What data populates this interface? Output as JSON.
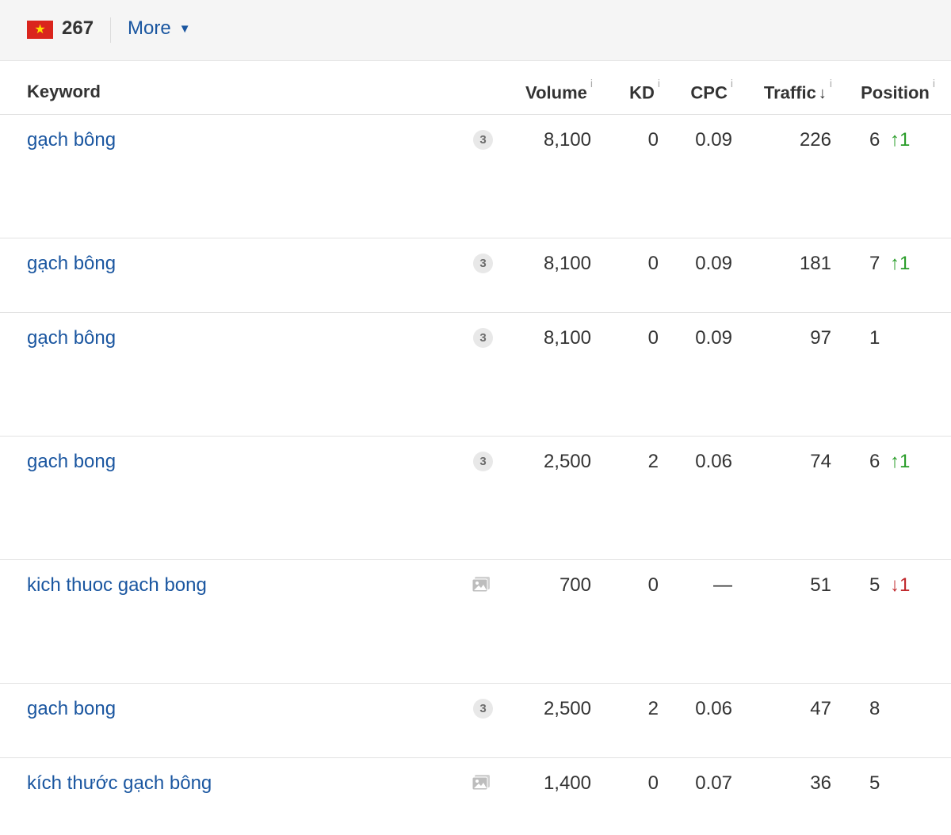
{
  "top": {
    "country_count": "267",
    "more_label": "More",
    "flag": "vietnam-flag"
  },
  "columns": {
    "keyword": "Keyword",
    "volume": "Volume",
    "kd": "KD",
    "cpc": "CPC",
    "traffic": "Traffic",
    "position": "Position",
    "info": "i",
    "sort": "↓"
  },
  "rows": [
    {
      "keyword": "gạch bông",
      "serp": "3",
      "serp_type": "count",
      "volume": "8,100",
      "kd": "0",
      "cpc": "0.09",
      "traffic": "226",
      "position": "6",
      "change": "↑1",
      "dir": "up"
    },
    {
      "keyword": "gạch bông",
      "serp": "3",
      "serp_type": "count",
      "volume": "8,100",
      "kd": "0",
      "cpc": "0.09",
      "traffic": "181",
      "position": "7",
      "change": "↑1",
      "dir": "up"
    },
    {
      "keyword": "gạch bông",
      "serp": "3",
      "serp_type": "count",
      "volume": "8,100",
      "kd": "0",
      "cpc": "0.09",
      "traffic": "97",
      "position": "1",
      "change": "",
      "dir": ""
    },
    {
      "keyword": "gach bong",
      "serp": "3",
      "serp_type": "count",
      "volume": "2,500",
      "kd": "2",
      "cpc": "0.06",
      "traffic": "74",
      "position": "6",
      "change": "↑1",
      "dir": "up"
    },
    {
      "keyword": "kich thuoc gach bong",
      "serp": "",
      "serp_type": "image",
      "volume": "700",
      "kd": "0",
      "cpc": "—",
      "traffic": "51",
      "position": "5",
      "change": "↓1",
      "dir": "down"
    },
    {
      "keyword": "gach bong",
      "serp": "3",
      "serp_type": "count",
      "volume": "2,500",
      "kd": "2",
      "cpc": "0.06",
      "traffic": "47",
      "position": "8",
      "change": "",
      "dir": ""
    },
    {
      "keyword": "kích thước gạch bông",
      "serp": "",
      "serp_type": "image",
      "volume": "1,400",
      "kd": "0",
      "cpc": "0.07",
      "traffic": "36",
      "position": "5",
      "change": "",
      "dir": ""
    }
  ]
}
